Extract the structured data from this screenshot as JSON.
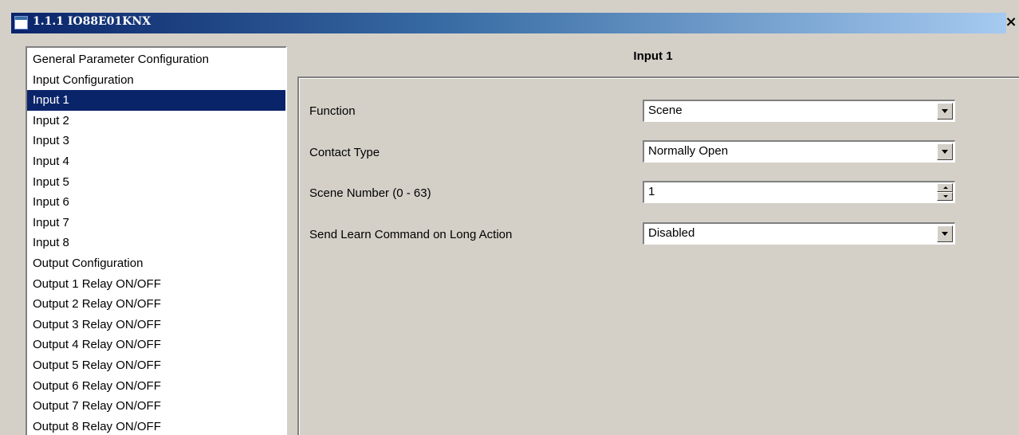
{
  "window": {
    "title": "1.1.1 IO88E01KNX",
    "close_label": "×"
  },
  "nav": {
    "items": [
      {
        "label": "General Parameter Configuration"
      },
      {
        "label": "Input Configuration"
      },
      {
        "label": "Input 1",
        "selected": true
      },
      {
        "label": "Input 2"
      },
      {
        "label": "Input 3"
      },
      {
        "label": "Input 4"
      },
      {
        "label": "Input 5"
      },
      {
        "label": "Input 6"
      },
      {
        "label": "Input 7"
      },
      {
        "label": "Input 8"
      },
      {
        "label": "Output Configuration"
      },
      {
        "label": "Output 1 Relay ON/OFF"
      },
      {
        "label": "Output 2 Relay ON/OFF"
      },
      {
        "label": "Output 3 Relay ON/OFF"
      },
      {
        "label": "Output 4 Relay ON/OFF"
      },
      {
        "label": "Output 5 Relay ON/OFF"
      },
      {
        "label": "Output 6 Relay ON/OFF"
      },
      {
        "label": "Output 7 Relay ON/OFF"
      },
      {
        "label": "Output 8 Relay ON/OFF"
      }
    ]
  },
  "panel": {
    "title": "Input 1",
    "params": {
      "function": {
        "label": "Function",
        "value": "Scene"
      },
      "contact_type": {
        "label": "Contact Type",
        "value": "Normally Open"
      },
      "scene_number": {
        "label": "Scene Number (0 - 63)",
        "value": "1"
      },
      "learn_command": {
        "label": "Send Learn Command on Long Action",
        "value": "Disabled"
      }
    }
  },
  "colors": {
    "selection": "#0a246a",
    "titlebar_start": "#0a246a",
    "titlebar_end": "#a6caf0",
    "background": "#d4d0c8"
  }
}
